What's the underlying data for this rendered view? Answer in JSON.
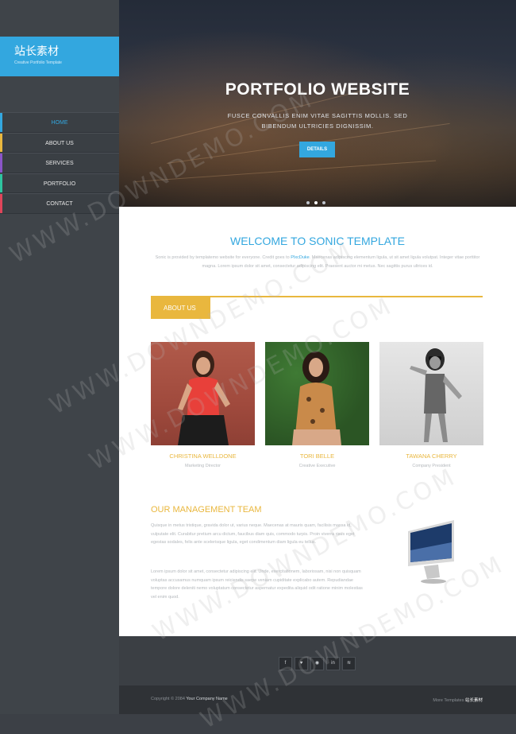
{
  "brand": {
    "logo_title": "站长素材",
    "logo_subtitle": "Creative Portfolio Template",
    "accent": "#33a7df",
    "gold": "#e9b73e"
  },
  "nav": [
    {
      "label": "HOME",
      "active": true
    },
    {
      "label": "ABOUT US",
      "color": "#e9b73e"
    },
    {
      "label": "SERVICES",
      "color": "#8a55c8"
    },
    {
      "label": "PORTFOLIO",
      "color": "#2ec4a0"
    },
    {
      "label": "CONTACT",
      "color": "#e0455a"
    }
  ],
  "hero": {
    "title": "PORTFOLIO WEBSITE",
    "text": "FUSCE CONVALLIS ENIM VITAE SAGITTIS MOLLIS. SED BIBENDUM ULTRICIES DIGNISSIM.",
    "button": "DETAILS"
  },
  "welcome": {
    "title": "WELCOME TO SONIC TEMPLATE",
    "text_before": "Sonic is provided by templatemo website for everyone. Credit goes to",
    "link": "PIxcDuke",
    "text_after": ". Maecenas adipiscing elementum ligula, ut sit amet ligula volutpat. Integer vitae porttitor magna. Lorem ipsum dolor sit amet, consectetur adipiscing elit. Praesent auctor mi metus. Nec sagittis purus ultrices id."
  },
  "about": {
    "tab": "ABOUT US"
  },
  "team": [
    {
      "name": "CHRISTINA WELLDONE",
      "role": "Marketing Director"
    },
    {
      "name": "TORI BELLE",
      "role": "Creative Executive"
    },
    {
      "name": "TAWANA CHERRY",
      "role": "Company President"
    }
  ],
  "management": {
    "title": "OUR MANAGEMENT TEAM",
    "p1": "Quisque in metus tristique, gravida dolor ut, varius neque. Maecenas at mauris quam, facilisis massa id, vulputate elit. Curabitur pretium arcu dictum, faucibus diam quis, commodo turpis. Proin viverra risus eget egestas sodales, felis ante scelerisque ligula, eget condimentum diam ligula eu tellus.",
    "p2": "Lorem ipsum dolor sit amet, consectetur adipiscing elit. Unde, exercitationem, laboriosam, nisi non quisquam voluptas accusamus numquam ipsum reiciendis saepe veniam cupiditate explicabo autem. Repudiandae tempore dolore deleniti nemo voluptatum consectetur aspernatur expedita aliquid odit ratione minim molestias vel enim quod."
  },
  "social": [
    "f",
    "t",
    "rss",
    "in",
    "rss"
  ],
  "footer": {
    "copyright": "Copyright © 2084",
    "company": "Your Company Name",
    "more": "More Templates",
    "more_brand": "站长素材"
  },
  "watermark": "WWW.DOWNDEMO.COM"
}
